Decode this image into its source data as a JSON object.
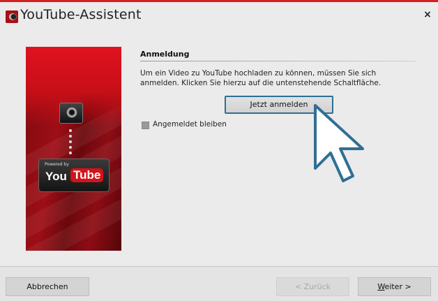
{
  "window": {
    "title": "YouTube-Assistent",
    "close_glyph": "×",
    "accent": "#d21f1f"
  },
  "banner": {
    "powered_by": "Powered by",
    "you": "You",
    "tube": "Tube"
  },
  "login": {
    "section_title": "Anmeldung",
    "description": "Um ein Video zu YouTube hochladen zu können, müssen Sie sich anmelden. Klicken Sie hierzu auf die untenstehende Schaltfläche.",
    "button_label": "Jetzt anmelden",
    "stay_signed_in_label": "Angemeldet bleiben",
    "stay_signed_in_checked": false
  },
  "footer": {
    "cancel_label": "Abbrechen",
    "back_label": "< Zurück",
    "next_prefix": "W",
    "next_rest": "eiter >"
  }
}
